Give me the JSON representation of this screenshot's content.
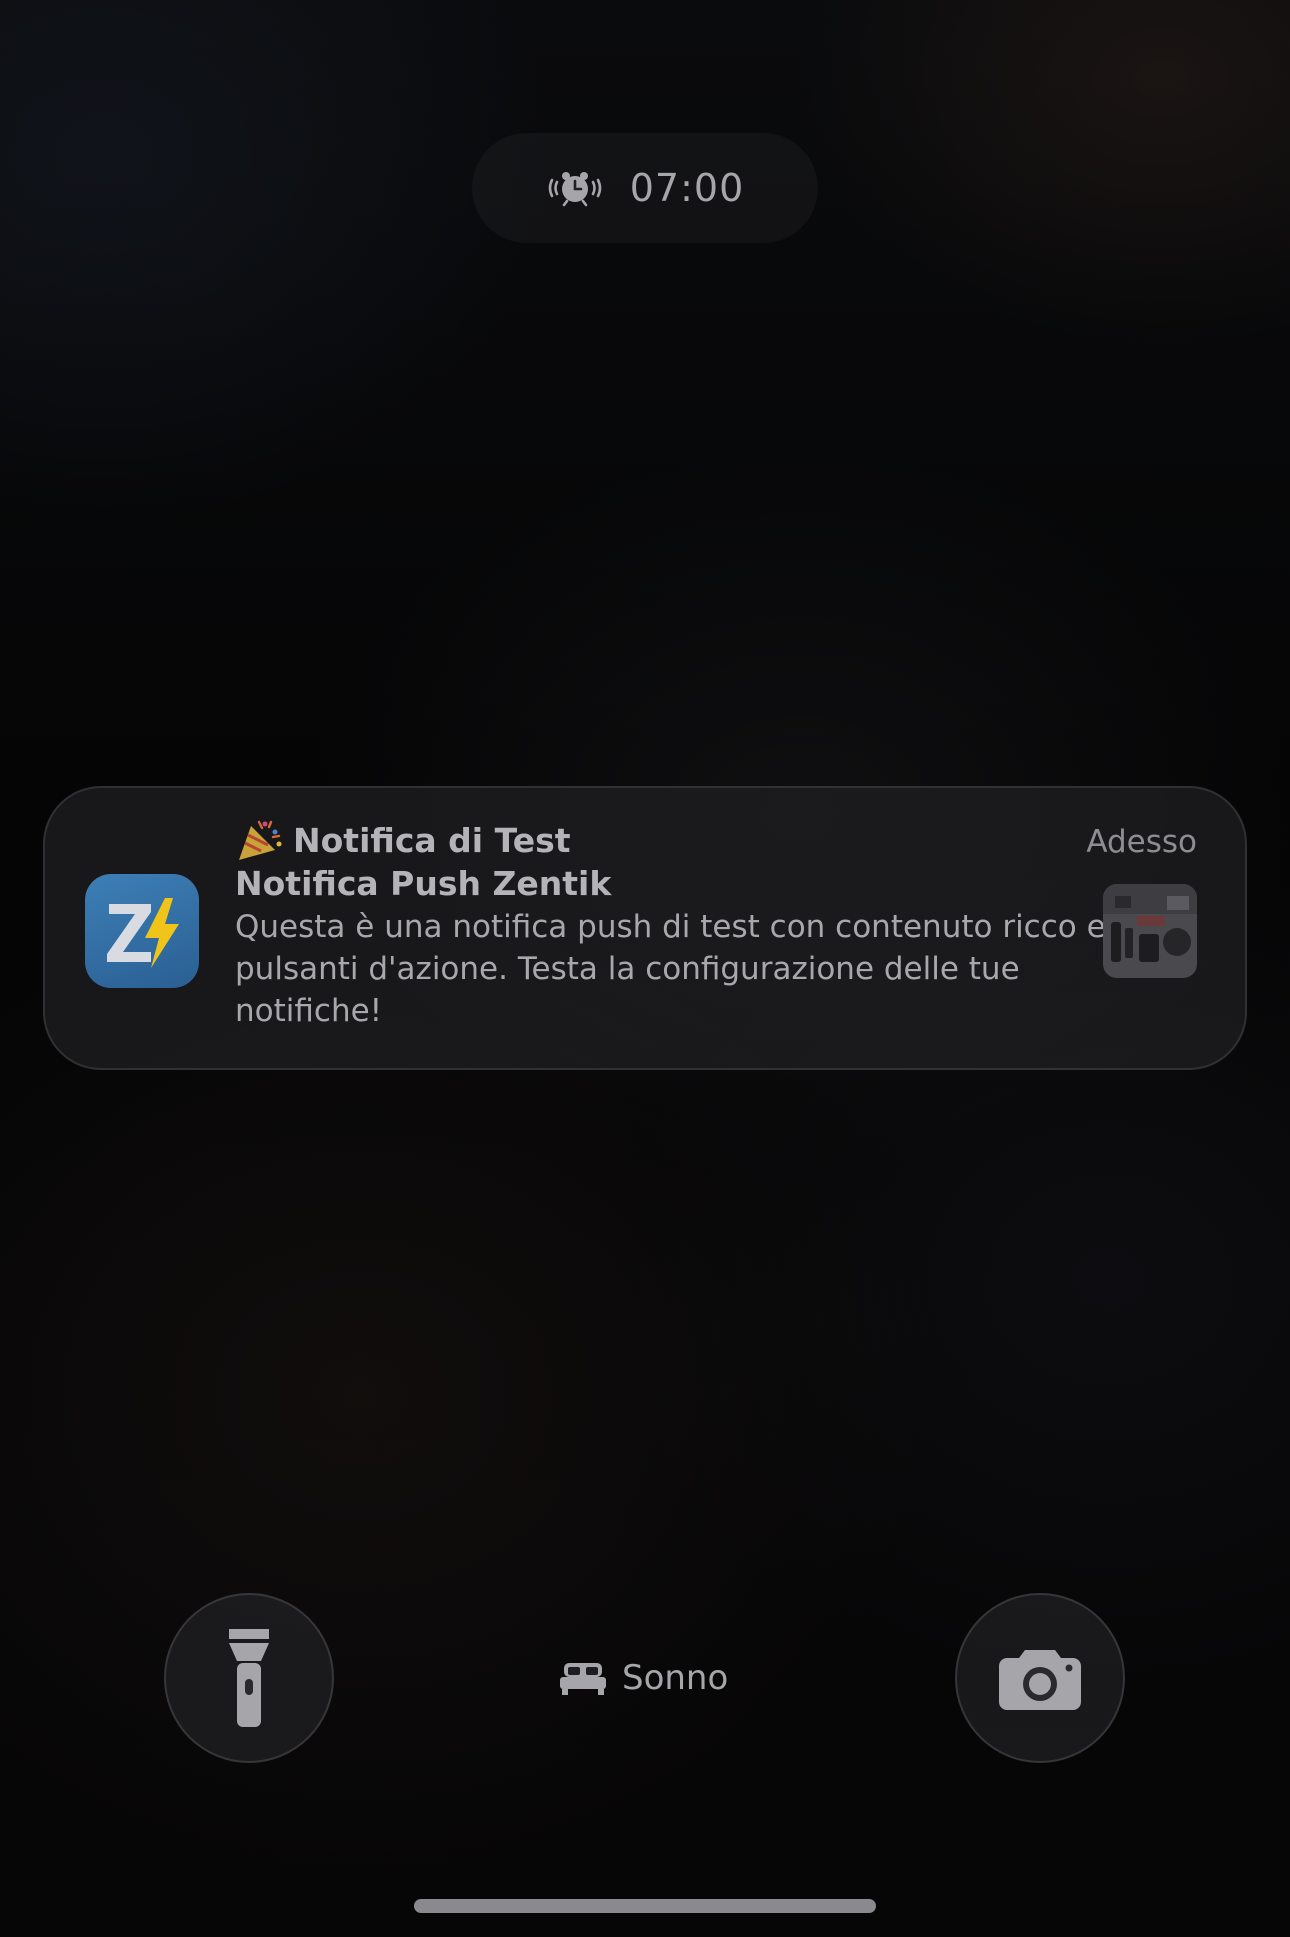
{
  "lockscreen": {
    "alarm": {
      "icon": "alarm-clock-ringing-icon",
      "time": "07:00"
    },
    "notification": {
      "app_icon": "zentik-app-icon",
      "emoji_icon": "party-popper-icon",
      "title": "Notifica di Test",
      "subtitle": "Notifica Push Zentik",
      "body": "Questa è una notifica push di test con contenuto ricco e pulsanti d'azione. Testa la configurazione delle tue notifiche!",
      "time": "Adesso",
      "thumbnail": "attachment-image-thumbnail"
    },
    "bottom": {
      "flashlight_icon": "flashlight-icon",
      "camera_icon": "camera-icon",
      "focus_icon": "bed-icon",
      "focus_label": "Sonno"
    }
  },
  "colors": {
    "background": "#050506",
    "card": "#202023",
    "text_primary": "#b4b4b8",
    "text_secondary": "#8e8e92",
    "app_icon_blue": "#3d7fb6",
    "bolt_yellow": "#f0c419"
  }
}
